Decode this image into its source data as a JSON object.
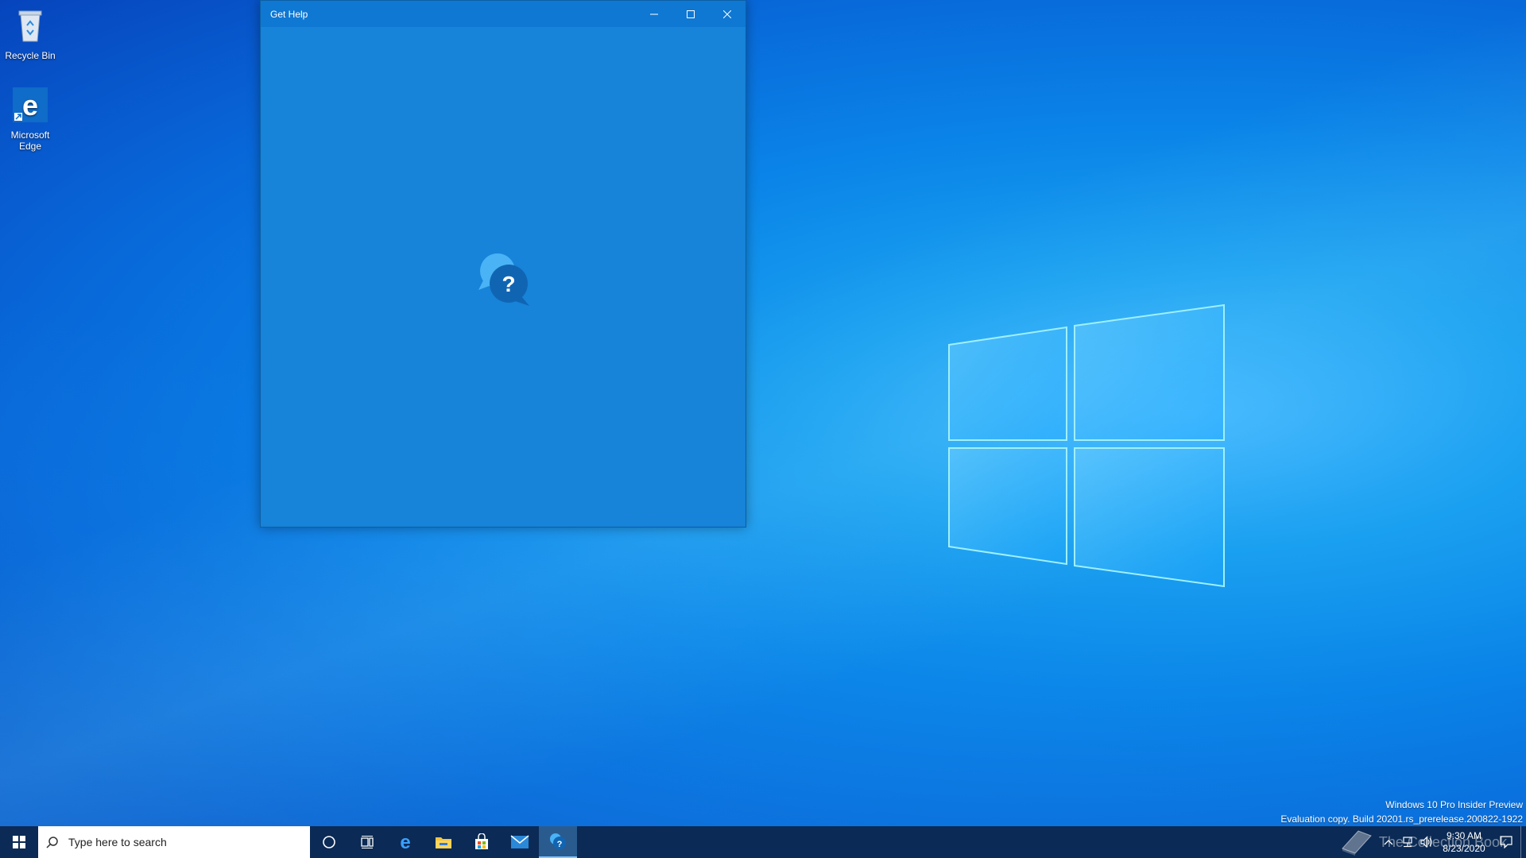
{
  "desktop": {
    "icons": [
      {
        "label": "Recycle Bin",
        "icon": "recycle-bin-icon"
      },
      {
        "label": "Microsoft Edge",
        "icon": "edge-icon"
      }
    ]
  },
  "window": {
    "title": "Get Help",
    "splash_icon": "get-help-icon",
    "colors": {
      "body": "#1783d9",
      "titlebar": "#0f78d3"
    }
  },
  "watermark": {
    "line1": "Windows 10 Pro Insider Preview",
    "line2": "Evaluation copy. Build 20201.rs_prerelease.200822-1922"
  },
  "taskbar": {
    "search_placeholder": "Type here to search",
    "apps": [
      "cortana",
      "task-view",
      "edge",
      "file-explorer",
      "store",
      "mail",
      "get-help"
    ],
    "time": "9:30 AM",
    "date": "8/23/2020",
    "overlay_text": "The Collection Book"
  }
}
